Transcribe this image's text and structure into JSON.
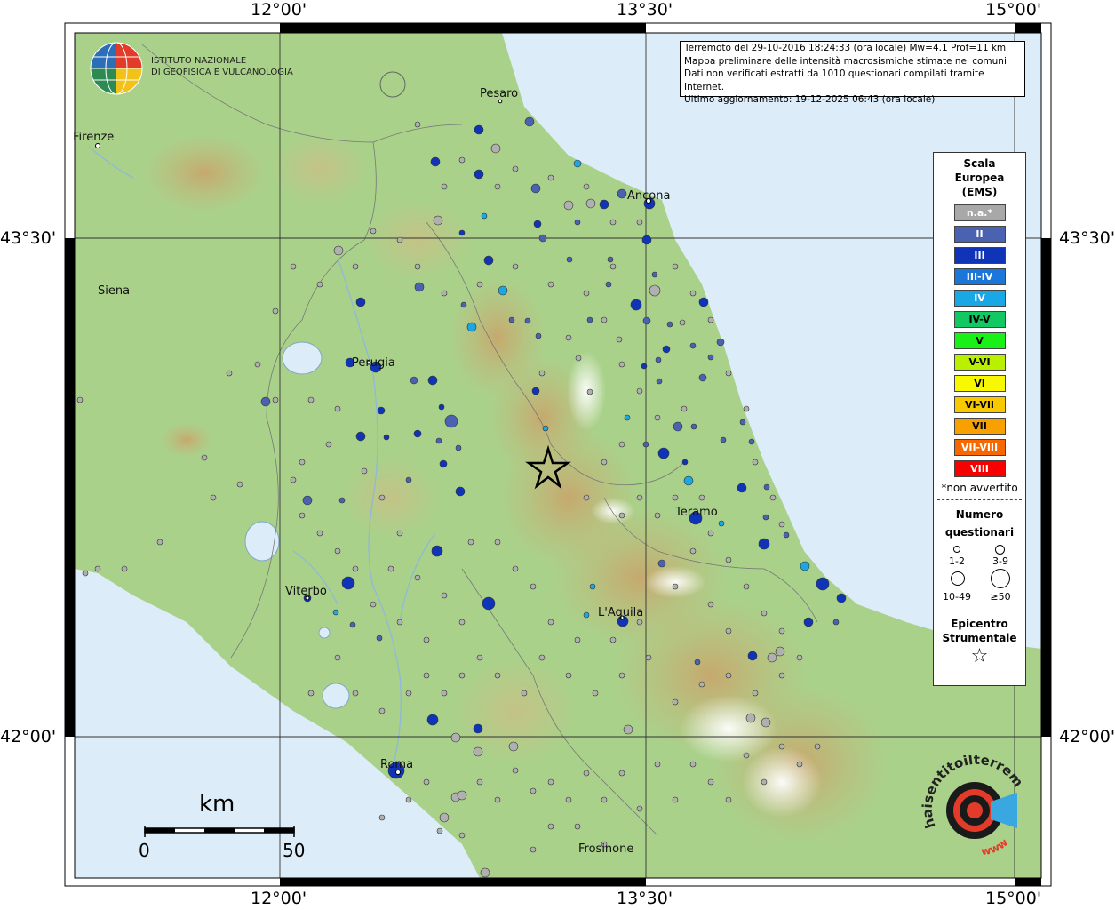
{
  "info": {
    "line1": "Terremoto del 29-10-2016 18:24:33 (ora locale) Mw=4.1 Prof=11 km",
    "line2": "Mappa preliminare delle intensità macrosismiche stimate nei comuni",
    "line3": "Dati non verificati estratti da 1010 questionari compilati tramite Internet.",
    "line4": "Ultimo aggiornamento: 19-12-2025 06:43 (ora locale)"
  },
  "logo": {
    "line1": "ISTITUTO NAZIONALE",
    "line2": "DI GEOFISICA E VULCANOLOGIA"
  },
  "coords": {
    "top": [
      "12°00'",
      "13°30'",
      "15°00'"
    ],
    "bottom": [
      "12°00'",
      "13°30'",
      "15°00'"
    ],
    "left": [
      "43°30'",
      "42°00'"
    ],
    "right": [
      "43°30'",
      "42°00'"
    ]
  },
  "cities": [
    {
      "name": "Pesaro"
    },
    {
      "name": "Firenze"
    },
    {
      "name": "Ancona"
    },
    {
      "name": "Siena"
    },
    {
      "name": "Perugia"
    },
    {
      "name": "Teramo"
    },
    {
      "name": "Viterbo"
    },
    {
      "name": "L'Aquila"
    },
    {
      "name": "Roma"
    },
    {
      "name": "Frosinone"
    }
  ],
  "legend": {
    "title": [
      "Scala",
      "Europea",
      "(EMS)"
    ],
    "scale": [
      {
        "label": "n.a.*",
        "color": "#a8a8a8",
        "text": "#ffffff"
      },
      {
        "label": "II",
        "color": "#4a62b0",
        "text": "#ffffff"
      },
      {
        "label": "III",
        "color": "#0f34b8",
        "text": "#ffffff"
      },
      {
        "label": "III-IV",
        "color": "#1a76d8",
        "text": "#ffffff"
      },
      {
        "label": "IV",
        "color": "#1aa7e6",
        "text": "#ffffff"
      },
      {
        "label": "IV-V",
        "color": "#12c862",
        "text": "#000000"
      },
      {
        "label": "V",
        "color": "#18f018",
        "text": "#000000"
      },
      {
        "label": "V-VI",
        "color": "#b8f000",
        "text": "#000000"
      },
      {
        "label": "VI",
        "color": "#f8f800",
        "text": "#000000"
      },
      {
        "label": "VI-VII",
        "color": "#f8c800",
        "text": "#000000"
      },
      {
        "label": "VII",
        "color": "#f8a000",
        "text": "#000000"
      },
      {
        "label": "VII-VIII",
        "color": "#f86800",
        "text": "#ffffff"
      },
      {
        "label": "VIII",
        "color": "#f80000",
        "text": "#ffffff"
      }
    ],
    "na_note": "*non avvertito",
    "questionari_title": [
      "Numero",
      "questionari"
    ],
    "sizes": [
      "1-2",
      "3-9",
      "10-49",
      "≥50"
    ],
    "epicentro_title": [
      "Epicentro",
      "Strumentale"
    ],
    "star": "☆"
  },
  "scalebar": {
    "unit": "km",
    "start": "0",
    "end": "50"
  },
  "watermark": {
    "text": "haisentitoilterremoto.it",
    "url": "www"
  },
  "colors": {
    "sea": "#dcecf8",
    "land": "#a6cf86",
    "grey": "#b0b0b0",
    "darkblue": "#0f34b8",
    "blue": "#4a62b0",
    "lightblue": "#1a76d8",
    "cyan": "#1aa7e6"
  }
}
